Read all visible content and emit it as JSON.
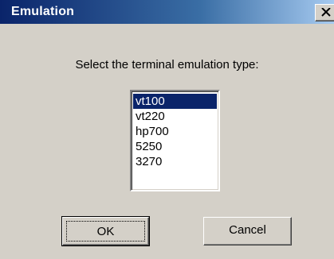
{
  "window": {
    "title": "Emulation"
  },
  "dialog": {
    "prompt": "Select the terminal emulation type:",
    "emulation_types": [
      {
        "label": "vt100",
        "selected": true
      },
      {
        "label": "vt220",
        "selected": false
      },
      {
        "label": "hp700",
        "selected": false
      },
      {
        "label": "5250",
        "selected": false
      },
      {
        "label": "3270",
        "selected": false
      }
    ],
    "ok_label": "OK",
    "cancel_label": "Cancel"
  },
  "icons": {
    "close": "close-icon"
  },
  "colors": {
    "title_bar_start": "#0a246a",
    "title_bar_end": "#a6caf0",
    "selection_bg": "#0a246a",
    "dialog_bg": "#d4d0c8"
  }
}
